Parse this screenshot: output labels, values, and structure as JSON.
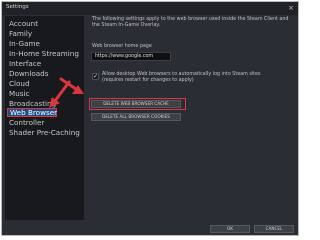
{
  "window": {
    "title": "Settings",
    "close_glyph": "×"
  },
  "sidebar": {
    "items": [
      {
        "label": "Account"
      },
      {
        "label": "Family"
      },
      {
        "label": "In-Game"
      },
      {
        "label": "In-Home Streaming"
      },
      {
        "label": "Interface"
      },
      {
        "label": "Downloads"
      },
      {
        "label": "Cloud"
      },
      {
        "label": "Music"
      },
      {
        "label": "Broadcasting"
      },
      {
        "label": "Web Browser",
        "selected": true
      },
      {
        "label": "Controller"
      },
      {
        "label": "Shader Pre-Caching"
      }
    ]
  },
  "content": {
    "info": "The following settings apply to the web browser used inside the Steam Client and the Steam In-Game Overlay.",
    "homepage_label": "Web browser home page",
    "homepage_value": "https://www.google.com",
    "checkbox_checked": true,
    "checkbox_label": "Allow desktop Web browsers to automatically log into Steam sites (requires restart for changes to apply)",
    "delete_cache_button": "DELETE WEB BROWSER CACHE",
    "delete_cookies_button": "DELETE ALL BROWSER COOKIES"
  },
  "footer": {
    "ok_label": "OK",
    "cancel_label": "CANCEL"
  },
  "colors": {
    "highlight": "#d9363e",
    "selected_bg": "#1f4f8a"
  },
  "icons": {
    "arrow_sidebar": "red-arrow-icon",
    "arrow_cache": "red-arrow-icon"
  }
}
